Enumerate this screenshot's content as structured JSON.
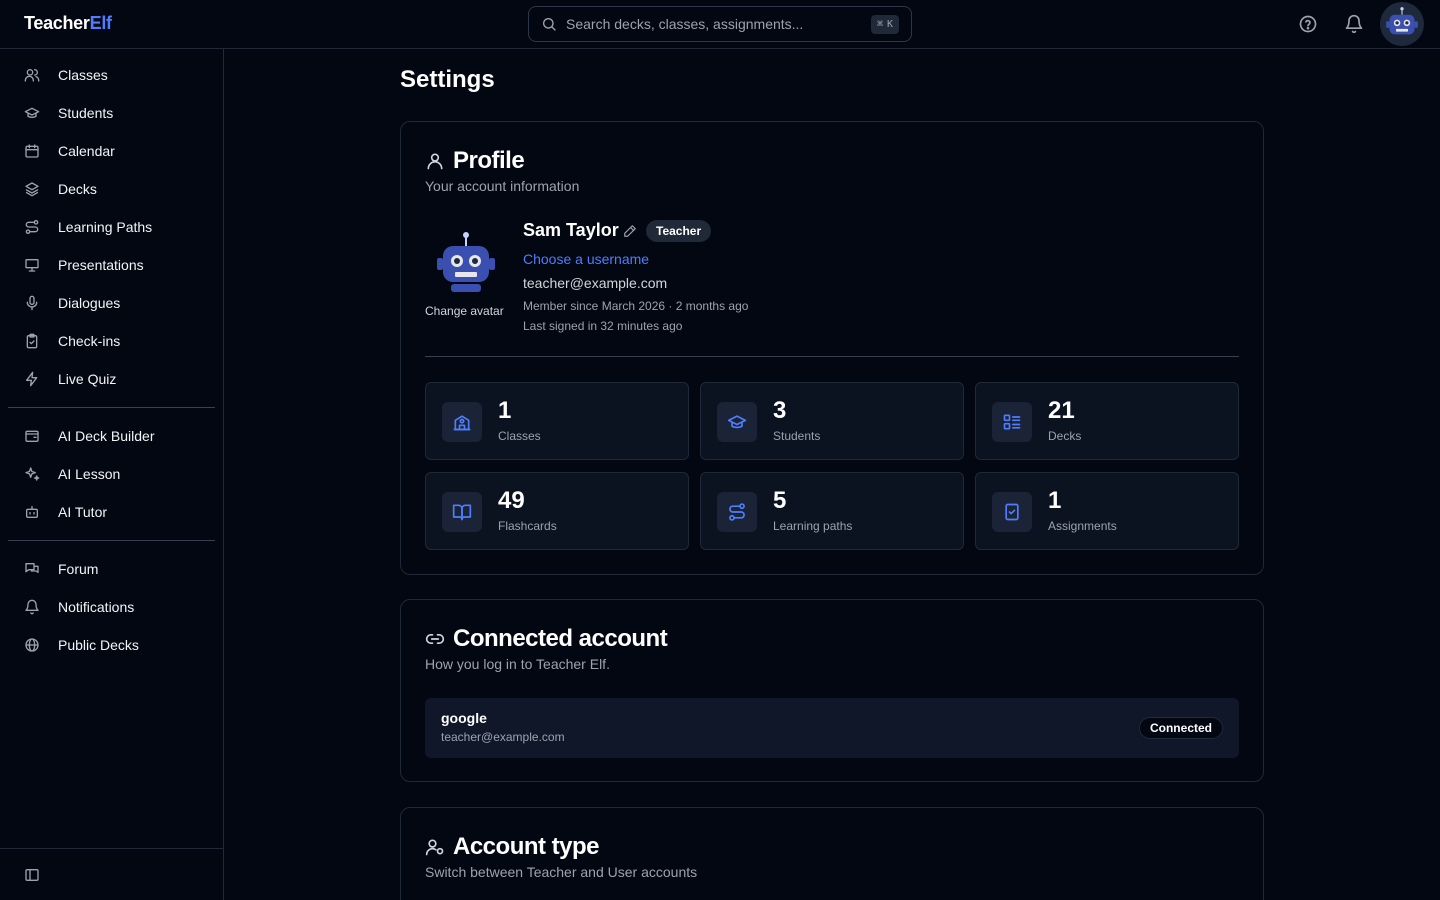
{
  "app": {
    "name_part1": "Teacher",
    "name_part2": "Elf"
  },
  "search": {
    "placeholder": "Search decks, classes, assignments...",
    "shortcut_symbol": "⌘",
    "shortcut_key": "K"
  },
  "topbar": {
    "icons": [
      "help-circle-icon",
      "bell-icon",
      "robot-avatar"
    ]
  },
  "sidebar": {
    "group1": [
      {
        "label": "Classes",
        "icon": "users-icon"
      },
      {
        "label": "Students",
        "icon": "graduation-cap-icon"
      },
      {
        "label": "Calendar",
        "icon": "calendar-icon"
      },
      {
        "label": "Decks",
        "icon": "layers-icon"
      },
      {
        "label": "Learning Paths",
        "icon": "route-icon"
      },
      {
        "label": "Presentations",
        "icon": "presentation-icon"
      },
      {
        "label": "Dialogues",
        "icon": "mic-icon"
      },
      {
        "label": "Check-ins",
        "icon": "clipboard-check-icon"
      },
      {
        "label": "Live Quiz",
        "icon": "zap-icon"
      }
    ],
    "group2": [
      {
        "label": "AI Deck Builder",
        "icon": "wallet-cards-icon"
      },
      {
        "label": "AI Lesson",
        "icon": "sparkles-icon"
      },
      {
        "label": "AI Tutor",
        "icon": "bot-icon"
      }
    ],
    "group3": [
      {
        "label": "Forum",
        "icon": "messages-icon"
      },
      {
        "label": "Notifications",
        "icon": "bell-icon"
      },
      {
        "label": "Public Decks",
        "icon": "globe-icon"
      }
    ]
  },
  "page": {
    "title": "Settings"
  },
  "profile": {
    "title": "Profile",
    "subtitle": "Your account information",
    "change_avatar": "Change avatar",
    "name": "Sam Taylor",
    "role": "Teacher",
    "username_link": "Choose a username",
    "email": "teacher@example.com",
    "member_since": "Member since March 2026 · 2 months ago",
    "last_signed": "Last signed in 32 minutes ago",
    "stats": [
      {
        "value": "1",
        "label": "Classes",
        "icon": "school-icon"
      },
      {
        "value": "3",
        "label": "Students",
        "icon": "graduation-cap-icon"
      },
      {
        "value": "21",
        "label": "Decks",
        "icon": "list-icon"
      },
      {
        "value": "49",
        "label": "Flashcards",
        "icon": "book-open-icon"
      },
      {
        "value": "5",
        "label": "Learning paths",
        "icon": "route-icon"
      },
      {
        "value": "1",
        "label": "Assignments",
        "icon": "notebook-check-icon"
      }
    ]
  },
  "connected": {
    "title": "Connected account",
    "subtitle": "How you log in to Teacher Elf.",
    "provider": "google",
    "email": "teacher@example.com",
    "status": "Connected"
  },
  "account_type": {
    "title": "Account type",
    "subtitle": "Switch between Teacher and User accounts"
  },
  "colors": {
    "accent": "#4f7dff",
    "background": "#030712",
    "card_inner": "#0b1220"
  }
}
